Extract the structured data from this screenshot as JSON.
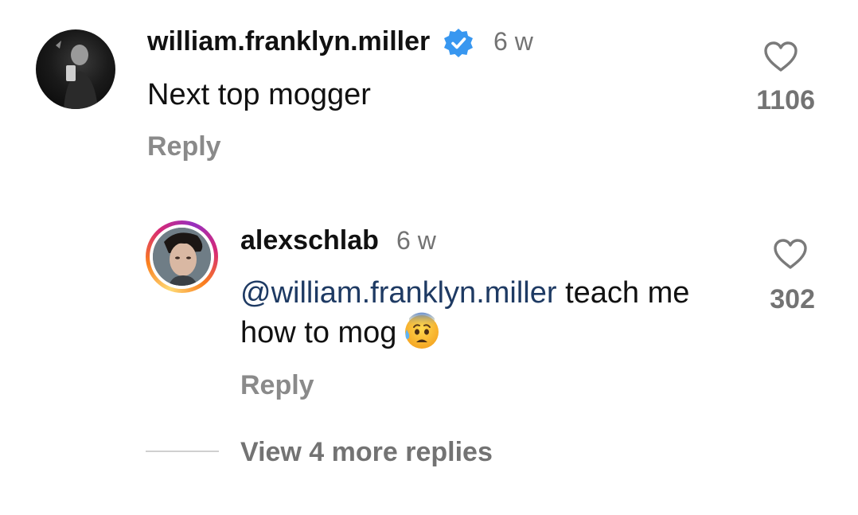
{
  "comment": {
    "username": "william.franklyn.miller",
    "verified": true,
    "time": "6 w",
    "text": "Next top mogger",
    "reply_label": "Reply",
    "likes": "1106",
    "like_icon": "heart-outline-icon"
  },
  "reply": {
    "username": "alexschlab",
    "time": "6 w",
    "mention": "@william.franklyn.miller",
    "text": " teach me how to mog",
    "emoji": "anxious-face-with-sweat",
    "reply_label": "Reply",
    "likes": "302",
    "like_icon": "heart-outline-icon",
    "story_ring": true
  },
  "thread": {
    "view_more_label": "View 4 more replies"
  },
  "colors": {
    "text": "#111111",
    "secondary": "#737373",
    "mention": "#1e3a63",
    "verified_badge": "#3897f0"
  }
}
